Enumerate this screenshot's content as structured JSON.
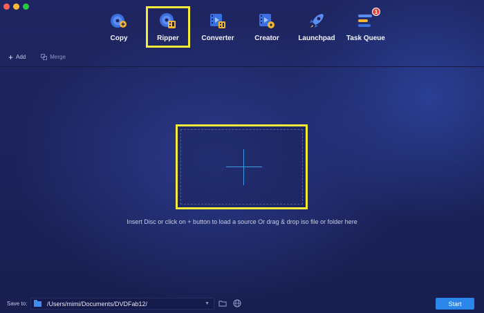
{
  "nav": {
    "items": [
      {
        "label": "Copy",
        "icon": "copy-disc-icon"
      },
      {
        "label": "Ripper",
        "icon": "ripper-disc-icon",
        "highlighted": true
      },
      {
        "label": "Converter",
        "icon": "converter-film-icon"
      },
      {
        "label": "Creator",
        "icon": "creator-film-icon"
      },
      {
        "label": "Launchpad",
        "icon": "launchpad-rocket-icon"
      },
      {
        "label": "Task Queue",
        "icon": "task-queue-icon",
        "badge": "1"
      }
    ]
  },
  "toolbar": {
    "add_label": "Add",
    "merge_label": "Merge"
  },
  "dropzone": {
    "hint": "Insert Disc or click on + button to load a source Or drag & drop iso file or folder here"
  },
  "bottom": {
    "save_to_label": "Save to:",
    "path": "/Users/mimi/Documents/DVDFab12/",
    "start_label": "Start"
  },
  "colors": {
    "highlight": "#f5ec3a",
    "accent": "#2b86ec",
    "background": "#1c2257"
  }
}
